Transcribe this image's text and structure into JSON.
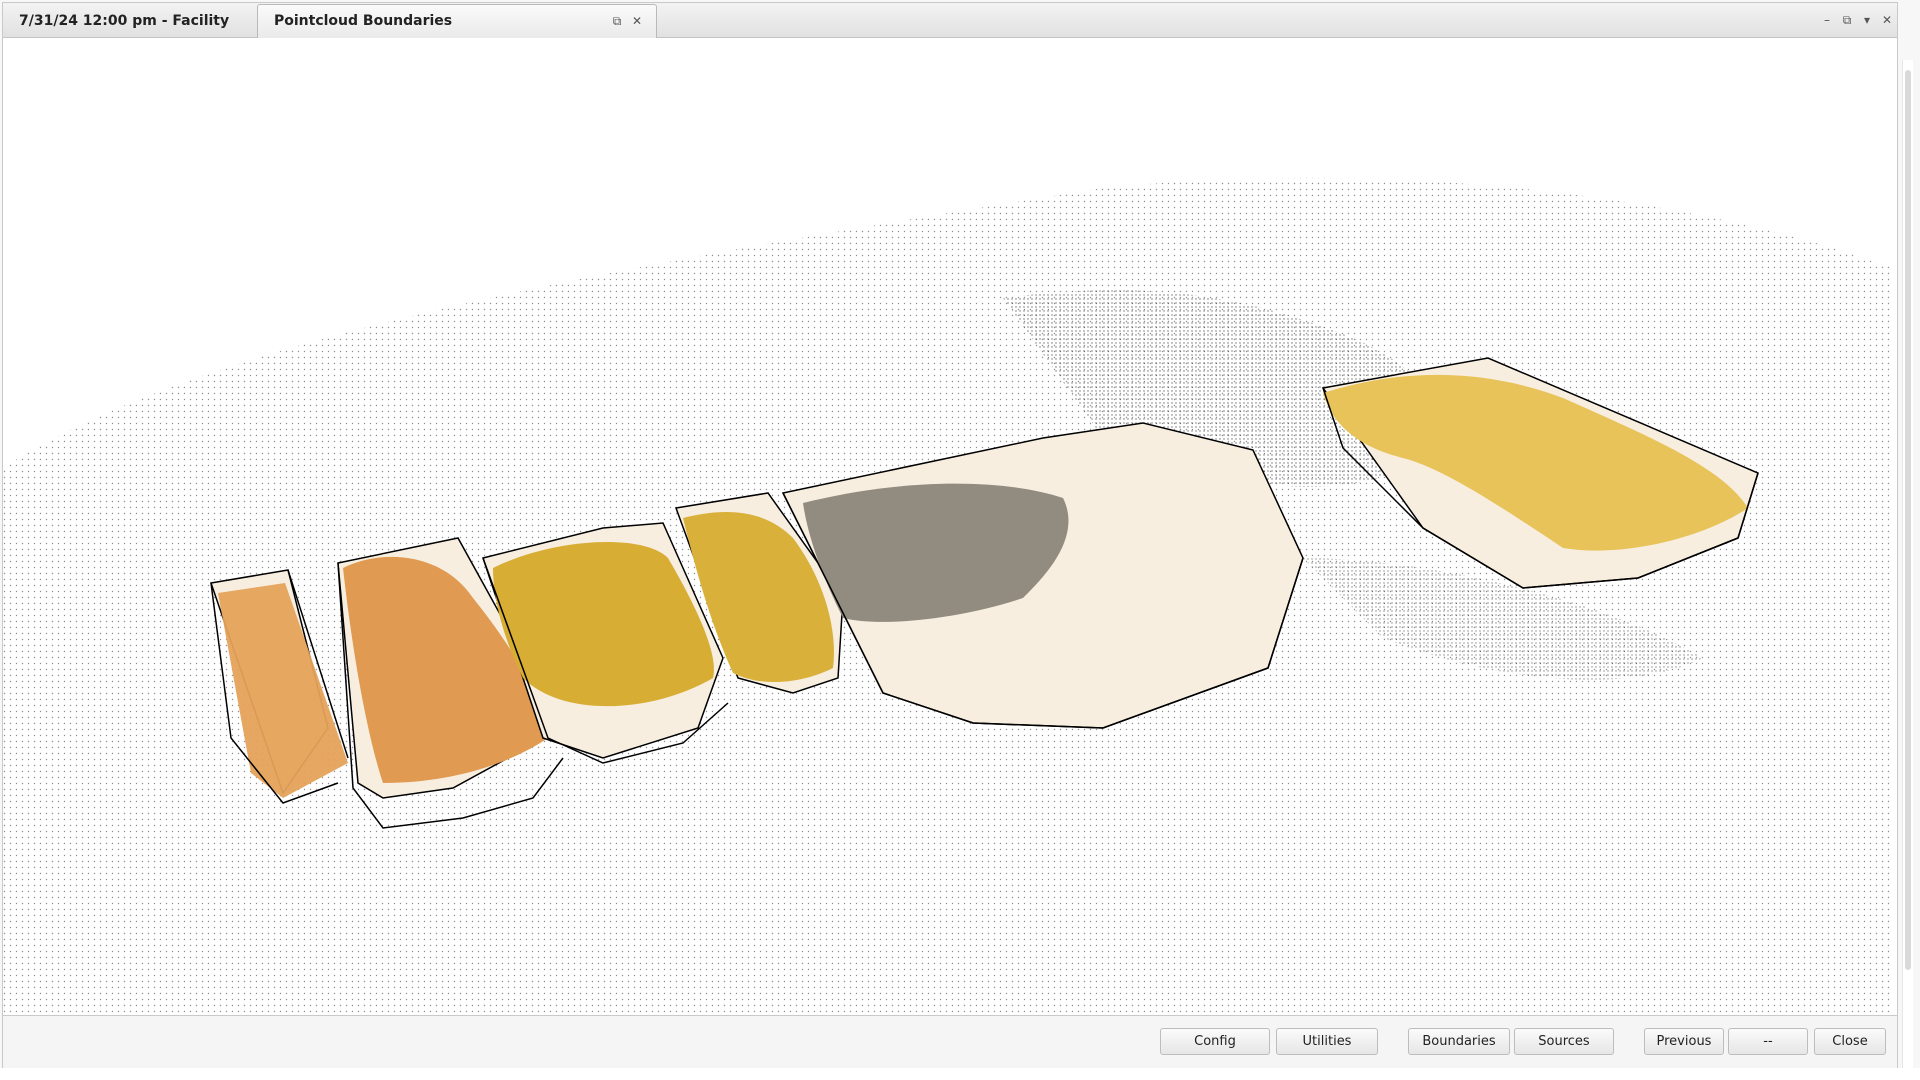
{
  "tabs": {
    "main_label": "7/31/24 12:00 pm - Facility",
    "active_label": "Pointcloud Boundaries"
  },
  "controls": {
    "tab_popout_icon": "⧉",
    "tab_close_icon": "✕",
    "minimize_icon": "–",
    "restore_icon": "⧉",
    "dropdown_icon": "▾",
    "close_icon": "✕"
  },
  "footer": {
    "buttons": [
      "Config",
      "Utilities",
      "Boundaries",
      "Sources",
      "Previous",
      "--",
      "Close"
    ]
  },
  "colors": {
    "pile_orange": "#e5a25a",
    "pile_gold": "#d8ad33",
    "pile_yellow": "#e8c35a",
    "pile_gray": "#8b8679",
    "boundary_fill": "#f7eee0",
    "wall_line": "#000000"
  }
}
